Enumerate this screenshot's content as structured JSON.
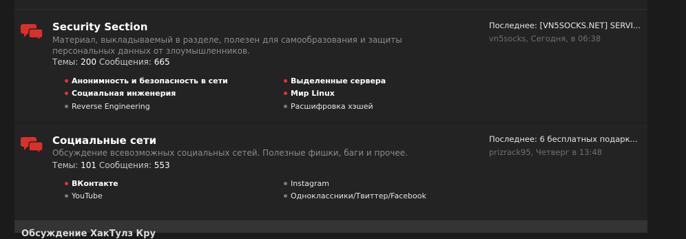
{
  "forums": [
    {
      "title": "Security Section",
      "description": "Материал, выкладываемый в разделе, полезен для самообразования и защиты персональных данных от злоумышленников.",
      "threads_label": "Темы:",
      "threads": "200",
      "posts_label": "Сообщения:",
      "posts": "665",
      "subforums": [
        {
          "label": "Анонимность и безопасность в сети",
          "unread": true
        },
        {
          "label": "Выделенные сервера",
          "unread": true
        },
        {
          "label": "Социальная инженерия",
          "unread": true
        },
        {
          "label": "Мир Linux",
          "unread": true
        },
        {
          "label": "Reverse Engineering",
          "unread": false
        },
        {
          "label": "Расшифровка хэшей",
          "unread": false
        }
      ],
      "last_post": {
        "title": "Последнее: [VN5SOCKS.NET] SERVI...",
        "user": "vn5socks",
        "time": ", Сегодня, в 06:38"
      }
    },
    {
      "title": "Социальные сети",
      "description": "Обсуждение всевозможных социальных сетей. Полезные фишки, баги и прочее.",
      "threads_label": "Темы:",
      "threads": "101",
      "posts_label": "Сообщения:",
      "posts": "553",
      "subforums": [
        {
          "label": "ВКонтакте",
          "unread": true
        },
        {
          "label": "Instagram",
          "unread": false
        },
        {
          "label": "YouTube",
          "unread": false
        },
        {
          "label": "Одноклассники/Твиттер/Facebook",
          "unread": false
        }
      ],
      "last_post": {
        "title": "Последнее: 6 бесплатных подарк...",
        "user": "prizrack95",
        "time": ", Четверг в 13:48"
      }
    }
  ],
  "next_category": {
    "title": "Обсуждение ХакТулз Кру"
  },
  "colors": {
    "unread_dot": "#e8332a",
    "read_dot": "#7a7a7a",
    "icon": "#d8312a"
  },
  "icons": {
    "forum": "speech-bubbles-icon"
  }
}
